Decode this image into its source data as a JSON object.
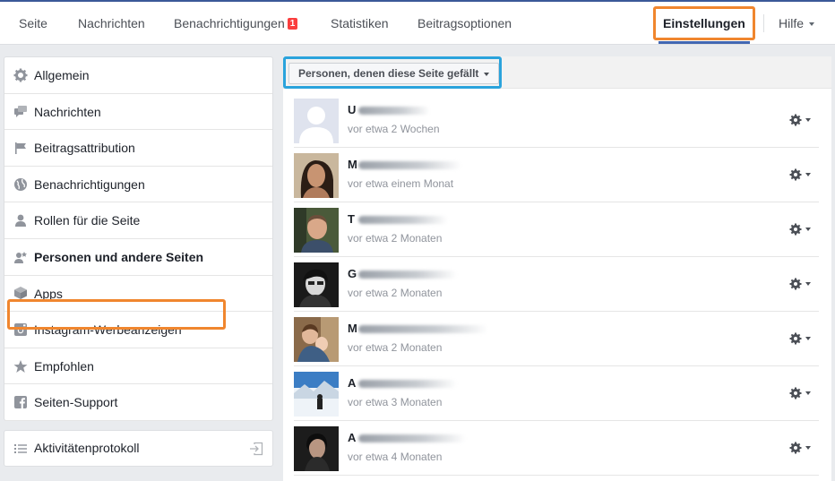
{
  "topnav": {
    "tabs": [
      {
        "label": "Seite"
      },
      {
        "label": "Nachrichten"
      },
      {
        "label": "Benachrichtigungen",
        "badge": "1"
      },
      {
        "label": "Statistiken"
      },
      {
        "label": "Beitragsoptionen"
      },
      {
        "label": "Einstellungen",
        "active": true
      },
      {
        "label": "Hilfe"
      }
    ]
  },
  "sidebar": {
    "items": [
      {
        "label": "Allgemein",
        "icon": "gear-icon"
      },
      {
        "label": "Nachrichten",
        "icon": "chat-icon"
      },
      {
        "label": "Beitragsattribution",
        "icon": "flag-icon"
      },
      {
        "label": "Benachrichtigungen",
        "icon": "globe-icon"
      },
      {
        "label": "Rollen für die Seite",
        "icon": "person-icon"
      },
      {
        "label": "Personen und andere Seiten",
        "icon": "people-icon",
        "active": true
      },
      {
        "label": "Apps",
        "icon": "cube-icon"
      },
      {
        "label": "Instagram-Werbeanzeigen",
        "icon": "instagram-icon"
      },
      {
        "label": "Empfohlen",
        "icon": "star-icon"
      },
      {
        "label": "Seiten-Support",
        "icon": "facebook-icon"
      }
    ],
    "activity": {
      "label": "Aktivitätenprotokoll",
      "icon": "list-icon"
    }
  },
  "main": {
    "filter_label": "Personen, denen diese Seite gefällt",
    "people": [
      {
        "initial": "U",
        "time": "vor etwa 2 Wochen"
      },
      {
        "initial": "M",
        "time": "vor etwa einem Monat"
      },
      {
        "initial": "T",
        "time": "vor etwa 2 Monaten"
      },
      {
        "initial": "G",
        "time": "vor etwa 2 Monaten"
      },
      {
        "initial": "M",
        "time": "vor etwa 2 Monaten"
      },
      {
        "initial": "A",
        "time": "vor etwa 3 Monaten"
      },
      {
        "initial": "A",
        "time": "vor etwa 4 Monaten"
      }
    ]
  },
  "colors": {
    "highlight_orange": "#f0862e",
    "highlight_blue": "#2aa3dc",
    "badge_red": "#fa3e3e",
    "brand_blue": "#4267b2"
  }
}
